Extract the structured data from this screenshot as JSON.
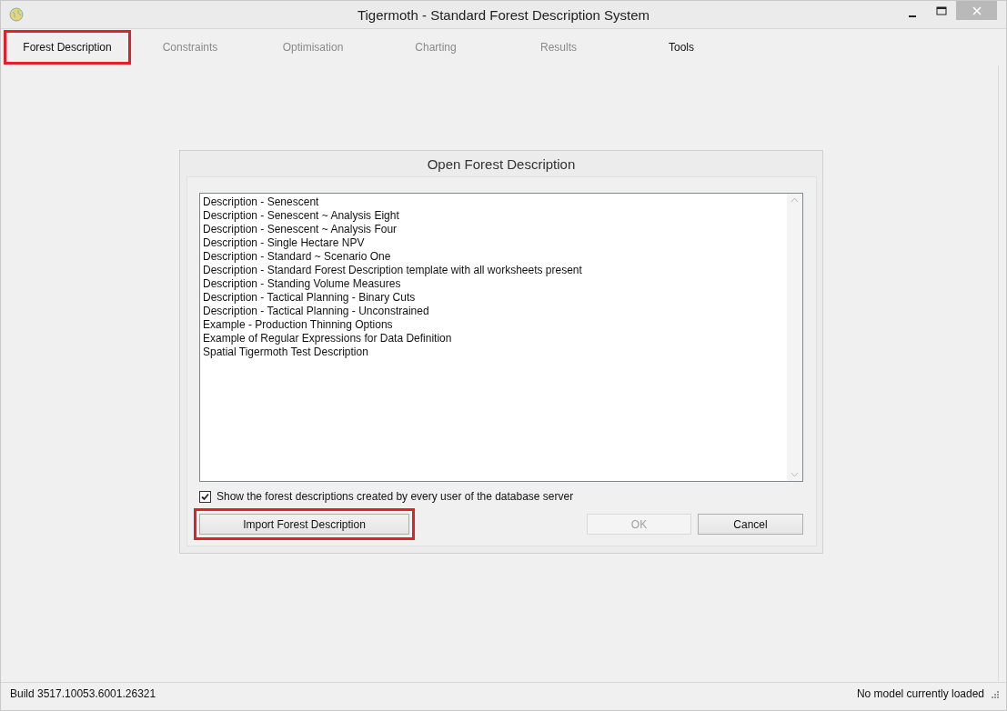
{
  "window": {
    "title": "Tigermoth - Standard Forest Description System"
  },
  "tabs": [
    {
      "label": "Forest Description",
      "disabled": false,
      "highlighted": true
    },
    {
      "label": "Constraints",
      "disabled": true,
      "highlighted": false
    },
    {
      "label": "Optimisation",
      "disabled": true,
      "highlighted": false
    },
    {
      "label": "Charting",
      "disabled": true,
      "highlighted": false
    },
    {
      "label": "Results",
      "disabled": true,
      "highlighted": false
    },
    {
      "label": "Tools",
      "disabled": false,
      "highlighted": false
    }
  ],
  "dialog": {
    "title": "Open Forest Description",
    "items": [
      "Description - Senescent",
      "Description - Senescent ~ Analysis Eight",
      "Description - Senescent ~ Analysis Four",
      "Description - Single Hectare NPV",
      "Description - Standard ~ Scenario One",
      "Description - Standard Forest Description template with all worksheets present",
      "Description - Standing Volume Measures",
      "Description - Tactical Planning - Binary Cuts",
      "Description - Tactical Planning - Unconstrained",
      "Example - Production Thinning Options",
      "Example of Regular Expressions for Data Definition",
      "Spatial Tigermoth Test Description"
    ],
    "show_all_users": {
      "label": "Show the forest descriptions created by every user of the database server",
      "checked": true
    },
    "buttons": [
      {
        "label": "Import Forest Description",
        "disabled": false,
        "highlighted": true
      },
      {
        "label": "OK",
        "disabled": true,
        "highlighted": false
      },
      {
        "label": "Cancel",
        "disabled": false,
        "highlighted": false
      }
    ]
  },
  "status_bar": {
    "left": "Build 3517.10053.6001.26321",
    "right": "No model currently loaded"
  }
}
